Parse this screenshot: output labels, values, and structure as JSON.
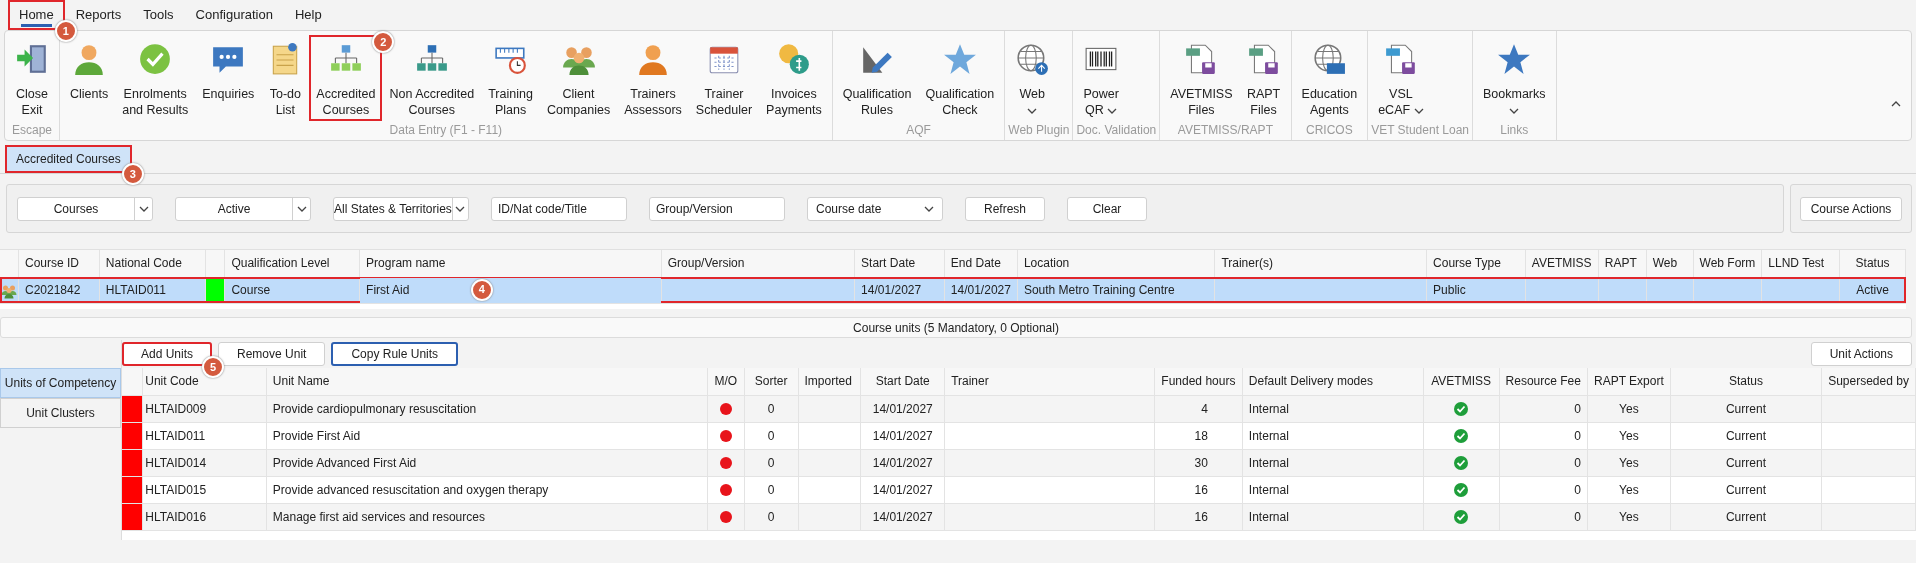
{
  "menu": [
    {
      "label": "Home",
      "selected": true,
      "callout": "1"
    },
    {
      "label": "Reports",
      "selected": false
    },
    {
      "label": "Tools",
      "selected": false
    },
    {
      "label": "Configuration",
      "selected": false
    },
    {
      "label": "Help",
      "selected": false
    }
  ],
  "ribbon": {
    "groups": [
      {
        "label": "Escape",
        "buttons": [
          {
            "label": "Close\nExit"
          }
        ]
      },
      {
        "label": "Data Entry (F1 - F11)",
        "buttons": [
          {
            "label": "Clients"
          },
          {
            "label": "Enrolments\nand Results"
          },
          {
            "label": "Enquiries"
          },
          {
            "label": "To-do\nList"
          },
          {
            "label": "Accredited\nCourses",
            "callout": "2"
          },
          {
            "label": "Non Accredited\nCourses"
          },
          {
            "label": "Training\nPlans"
          },
          {
            "label": "Client\nCompanies"
          },
          {
            "label": "Trainers\nAssessors"
          },
          {
            "label": "Trainer\nScheduler"
          },
          {
            "label": "Invoices\nPayments"
          }
        ]
      },
      {
        "label": "AQF",
        "buttons": [
          {
            "label": "Qualification\nRules"
          },
          {
            "label": "Qualification\nCheck"
          }
        ]
      },
      {
        "label": "Web Plugin",
        "buttons": [
          {
            "label": "Web",
            "dropdown": true
          }
        ]
      },
      {
        "label": "Doc. Validation",
        "buttons": [
          {
            "label": "Power\nQR",
            "dropdown": true
          }
        ]
      },
      {
        "label": "AVETMISS/RAPT",
        "buttons": [
          {
            "label": "AVETMISS\nFiles"
          },
          {
            "label": "RAPT\nFiles"
          }
        ]
      },
      {
        "label": "CRICOS",
        "buttons": [
          {
            "label": "Education\nAgents"
          }
        ]
      },
      {
        "label": "VET Student Loan",
        "buttons": [
          {
            "label": "VSL\neCAF",
            "dropdown": true
          }
        ]
      },
      {
        "label": "Links",
        "buttons": [
          {
            "label": "Bookmarks",
            "dropdown": true
          }
        ]
      }
    ]
  },
  "page_tabs": [
    {
      "label": "Accredited Courses",
      "selected": true,
      "callout": "3"
    }
  ],
  "filters": [
    {
      "kind": "select",
      "value": "Courses"
    },
    {
      "kind": "select",
      "value": "Active"
    },
    {
      "kind": "select",
      "value": "All States & Territories"
    },
    {
      "kind": "input",
      "placeholder": "ID/Nat code/Title"
    },
    {
      "kind": "input",
      "placeholder": "Group/Version"
    },
    {
      "kind": "dropdown",
      "value": "Course date"
    },
    {
      "kind": "button",
      "label": "Refresh"
    },
    {
      "kind": "button",
      "label": "Clear"
    }
  ],
  "course_actions": "Course Actions",
  "courses": {
    "columns": [
      {
        "label": "Course ID"
      },
      {
        "label": "National Code"
      },
      {
        "kind": "color"
      },
      {
        "label": "Qualification Level"
      },
      {
        "label": "Program name"
      },
      {
        "label": "Group/Version"
      },
      {
        "label": "Start Date"
      },
      {
        "label": "End Date"
      },
      {
        "label": "Location"
      },
      {
        "label": "Trainer(s)"
      },
      {
        "label": "Course Type"
      },
      {
        "label": "AVETMISS"
      },
      {
        "label": "RAPT"
      },
      {
        "label": "Web"
      },
      {
        "label": "Web Form"
      },
      {
        "label": "LLND Test"
      },
      {
        "label": "Status"
      }
    ],
    "rows": [
      {
        "selected": true,
        "callout": "4",
        "cells": [
          "C2021842",
          "HLTAID011",
          {
            "color": "#00ff00"
          },
          "Course",
          "First Aid",
          null,
          "14/01/2027",
          "14/01/2027",
          "South Metro Training Centre",
          null,
          "Public",
          null,
          null,
          null,
          null,
          null,
          "Active"
        ]
      }
    ]
  },
  "units_summary": "Course units (5 Mandatory, 0 Optional)",
  "unit_tabs": [
    {
      "label": "Units of Competency",
      "selected": true
    },
    {
      "label": "Unit Clusters",
      "selected": false
    }
  ],
  "unit_toolbar": [
    {
      "label": "Add Units",
      "callout": "5",
      "focused": false
    },
    {
      "label": "Remove Unit",
      "focused": false
    },
    {
      "label": "Copy Rule Units",
      "focused": true
    }
  ],
  "unit_actions": "Unit Actions",
  "units": {
    "columns": [
      "Unit Code",
      "Unit Name",
      "M/O",
      "Sorter",
      "Imported",
      "Start Date",
      "Trainer",
      "Funded hours",
      "Default Delivery modes",
      "AVETMISS",
      "Resource Fee",
      "RAPT Export",
      "Status",
      "Superseded by"
    ],
    "rows": [
      {
        "color": "#ff0000",
        "code": "HLTAID009",
        "name": "Provide cardiopulmonary resuscitation",
        "mandatory": true,
        "sorter": "0",
        "start_date": "14/01/2027",
        "funded_hours": "4",
        "delivery": "Internal",
        "avetmiss": true,
        "resource_fee": "0",
        "rapt_export": "Yes",
        "status": "Current"
      },
      {
        "color": "#ff0000",
        "code": "HLTAID011",
        "name": "Provide First Aid",
        "mandatory": true,
        "sorter": "0",
        "start_date": "14/01/2027",
        "funded_hours": "18",
        "delivery": "Internal",
        "avetmiss": true,
        "resource_fee": "0",
        "rapt_export": "Yes",
        "status": "Current"
      },
      {
        "color": "#ff0000",
        "code": "HLTAID014",
        "name": "Provide Advanced First Aid",
        "mandatory": true,
        "sorter": "0",
        "start_date": "14/01/2027",
        "funded_hours": "30",
        "delivery": "Internal",
        "avetmiss": true,
        "resource_fee": "0",
        "rapt_export": "Yes",
        "status": "Current"
      },
      {
        "color": "#ff0000",
        "code": "HLTAID015",
        "name": "Provide advanced resuscitation and oxygen therapy",
        "mandatory": true,
        "sorter": "0",
        "start_date": "14/01/2027",
        "funded_hours": "16",
        "delivery": "Internal",
        "avetmiss": true,
        "resource_fee": "0",
        "rapt_export": "Yes",
        "status": "Current"
      },
      {
        "color": "#ff0000",
        "code": "HLTAID016",
        "name": "Manage first aid services and resources",
        "mandatory": true,
        "sorter": "0",
        "start_date": "14/01/2027",
        "funded_hours": "16",
        "delivery": "Internal",
        "avetmiss": true,
        "resource_fee": "0",
        "rapt_export": "Yes",
        "status": "Current"
      }
    ]
  }
}
